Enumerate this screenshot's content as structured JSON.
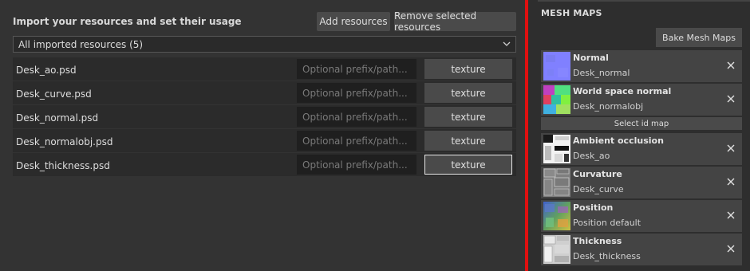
{
  "import": {
    "title": "Import your resources and set their usage",
    "add_button": "Add resources",
    "remove_button": "Remove selected resources",
    "filter": "All imported resources (5)",
    "prefix_placeholder": "Optional prefix/path...",
    "resources": [
      {
        "name": "Desk_ao.psd",
        "usage": "texture"
      },
      {
        "name": "Desk_curve.psd",
        "usage": "texture"
      },
      {
        "name": "Desk_normal.psd",
        "usage": "texture"
      },
      {
        "name": "Desk_normalobj.psd",
        "usage": "texture"
      },
      {
        "name": "Desk_thickness.psd",
        "usage": "texture"
      }
    ]
  },
  "mesh_maps": {
    "title": "MESH MAPS",
    "bake_button": "Bake Mesh Maps",
    "select_id_map": "Select id map",
    "maps": [
      {
        "name": "Normal",
        "value": "Desk_normal",
        "thumb": "normal"
      },
      {
        "name": "World space normal",
        "value": "Desk_normalobj",
        "thumb": "world-normal"
      },
      {
        "name": "Ambient occlusion",
        "value": "Desk_ao",
        "thumb": "ao"
      },
      {
        "name": "Curvature",
        "value": "Desk_curve",
        "thumb": "curvature"
      },
      {
        "name": "Position",
        "value": "Position default",
        "thumb": "position"
      },
      {
        "name": "Thickness",
        "value": "Desk_thickness",
        "thumb": "thickness"
      }
    ]
  },
  "colors": {
    "divider": "#e01010",
    "panel": "#333333",
    "button": "#4a4a4a"
  }
}
